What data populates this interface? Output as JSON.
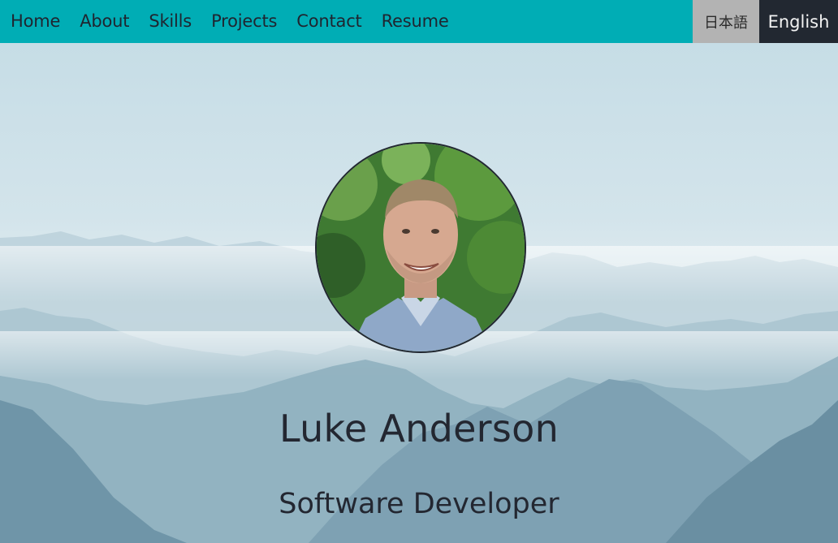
{
  "nav": {
    "items": [
      {
        "label": "Home"
      },
      {
        "label": "About"
      },
      {
        "label": "Skills"
      },
      {
        "label": "Projects"
      },
      {
        "label": "Contact"
      },
      {
        "label": "Resume"
      }
    ],
    "languages": {
      "japanese": "日本語",
      "english": "English",
      "active": "English"
    }
  },
  "hero": {
    "name": "Luke Anderson",
    "title": "Software Developer",
    "background": "misty-mountains-image",
    "avatar": "profile-photo"
  },
  "colors": {
    "navbar": "#00adb5",
    "active_lang": "#222831",
    "inactive_lang": "#b3b3b3",
    "text": "#232731"
  }
}
